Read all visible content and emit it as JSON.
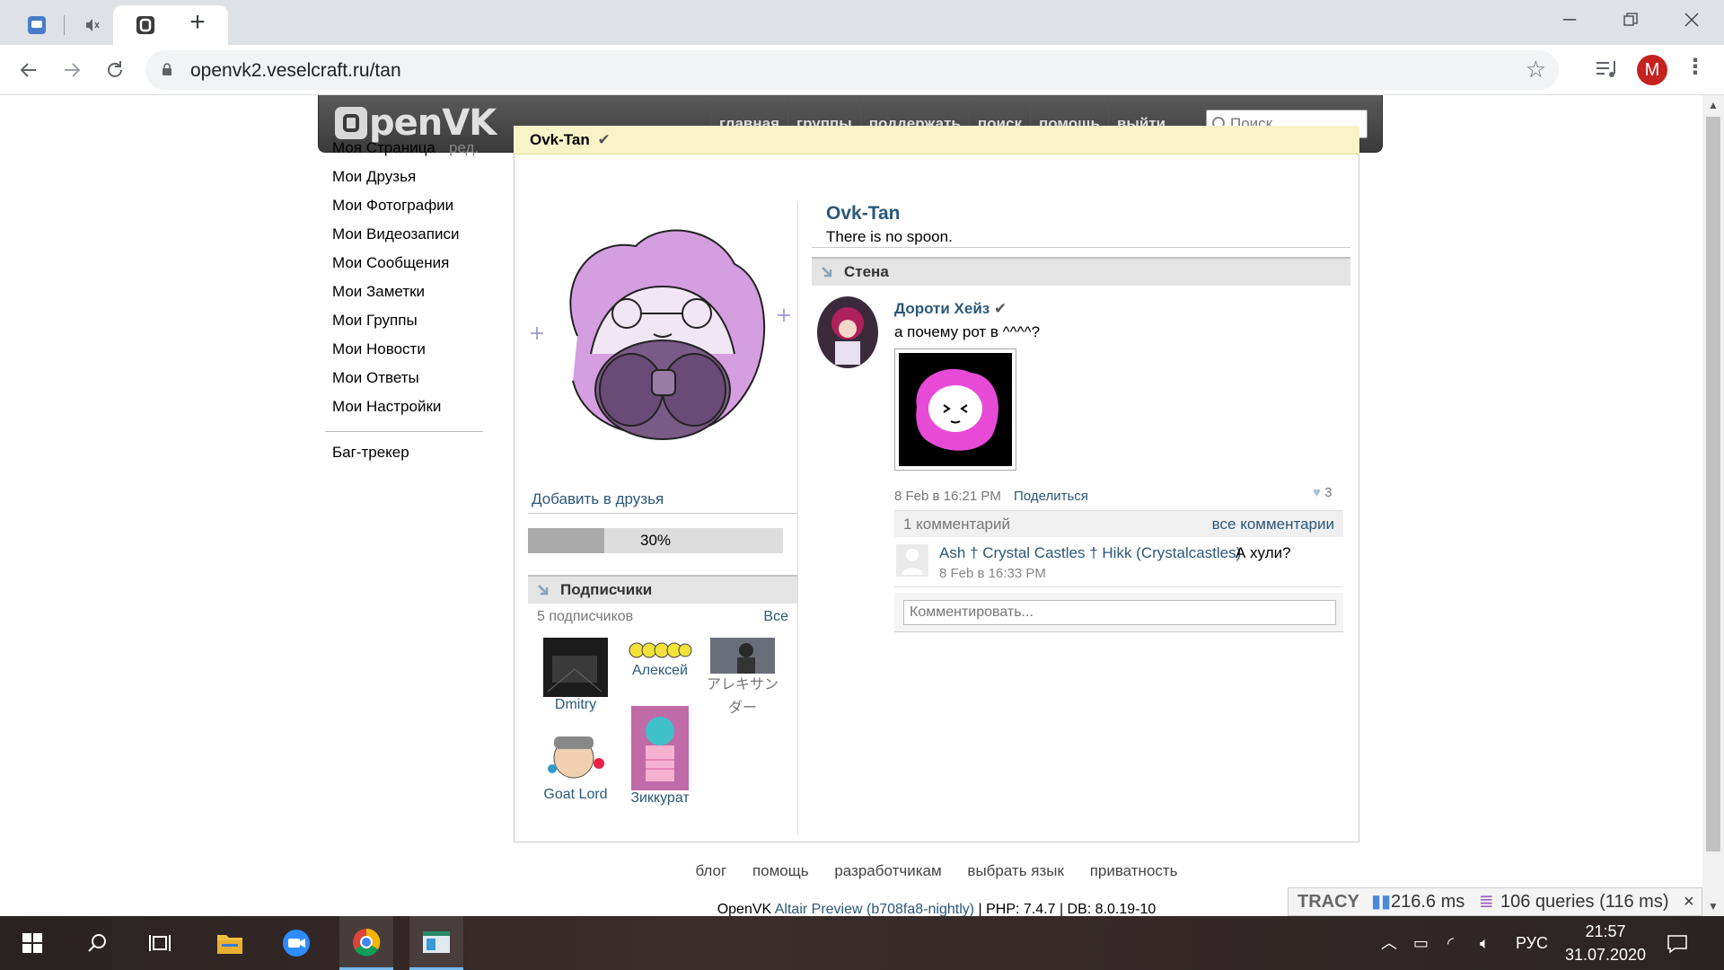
{
  "browser": {
    "active_tab_icon": "openvk-favicon",
    "url": "openvk2.veselcraft.ru/tan",
    "profile_initial": "M"
  },
  "site": {
    "nav": [
      "главная",
      "группы",
      "поддержать",
      "поиск",
      "помощь",
      "выйти"
    ],
    "search_placeholder": "Поиск"
  },
  "leftmenu": {
    "items": [
      "Моя Страница",
      "Мои Друзья",
      "Мои Фотографии",
      "Мои Видеозаписи",
      "Мои Сообщения",
      "Мои Заметки",
      "Мои Группы",
      "Мои Новости",
      "Мои Ответы",
      "Мои Настройки"
    ],
    "edit": "ред.",
    "bugtracker": "Баг-трекер"
  },
  "profile": {
    "title": "Ovk-Tan",
    "verified_icon": "checkmark-icon",
    "name": "Ovk-Tan",
    "status": "There is no spoon.",
    "add_friend": "Добавить в друзья",
    "completeness_label": "30%",
    "completeness_value": 0.3
  },
  "subscribers": {
    "heading": "Подписчики",
    "count": "5 подписчиков",
    "all": "Все",
    "list": [
      "Dmitry",
      "Алексей",
      "アレキサンダー",
      "Goat Lord",
      "Зиккурат"
    ]
  },
  "wall": {
    "heading": "Стена",
    "post": {
      "author": "Дороти Хейз",
      "text": "а почему рот в ^^^^?",
      "date": "8 Feb в 16:21 PM",
      "share": "Поделиться",
      "likes": "3",
      "comments_count": "1 комментарий",
      "all_comments": "все комментарии",
      "comment": {
        "author": "Ash † Crystal Castles † Hikk (Crystalcastles)",
        "text": "А хули?",
        "date": "8 Feb в 16:33 PM"
      },
      "comment_placeholder": "Комментировать..."
    }
  },
  "footer": {
    "links": [
      "блог",
      "помощь",
      "разработчикам",
      "выбрать язык",
      "приватность"
    ],
    "version_prefix": "OpenVK",
    "version_link": "Altair Preview (b708fa8-nightly)",
    "version_suffix": "| PHP: 7.4.7 | DB: 8.0.19-10"
  },
  "tracy": {
    "label": "TRACY",
    "time": "216.6 ms",
    "queries": "106 queries (116 ms)",
    "close": "×"
  },
  "taskbar": {
    "lang": "РУС",
    "time": "21:57",
    "date": "31.07.2020"
  }
}
